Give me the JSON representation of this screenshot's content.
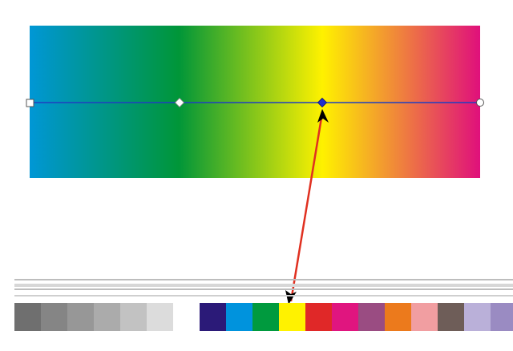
{
  "gradient": {
    "stops": [
      {
        "offset": 0.0,
        "color": "#0097d6"
      },
      {
        "offset": 0.33,
        "color": "#009639"
      },
      {
        "offset": 0.65,
        "color": "#fff200"
      },
      {
        "offset": 1.0,
        "color": "#e0107c"
      }
    ],
    "handle_positions": [
      0.0,
      0.33,
      0.65,
      1.0
    ],
    "selected_handle": 2,
    "line_color": "#1f3fbf"
  },
  "palette": {
    "swatches": [
      {
        "name": "gray-70",
        "color": "#6f6f6f"
      },
      {
        "name": "gray-60",
        "color": "#858585"
      },
      {
        "name": "gray-50",
        "color": "#979797"
      },
      {
        "name": "gray-40",
        "color": "#ababab"
      },
      {
        "name": "gray-30",
        "color": "#c2c2c2"
      },
      {
        "name": "gray-20",
        "color": "#dcdcdc"
      },
      {
        "name": "white",
        "color": "#ffffff"
      },
      {
        "name": "navy",
        "color": "#2b1a78"
      },
      {
        "name": "cyan",
        "color": "#0093dd"
      },
      {
        "name": "green",
        "color": "#009a3e"
      },
      {
        "name": "yellow",
        "color": "#fff200"
      },
      {
        "name": "red",
        "color": "#e02828"
      },
      {
        "name": "magenta",
        "color": "#e0157f"
      },
      {
        "name": "plum",
        "color": "#9a4c82"
      },
      {
        "name": "orange",
        "color": "#ec7a1c"
      },
      {
        "name": "pink",
        "color": "#f19ea1"
      },
      {
        "name": "taupe",
        "color": "#6e5d58"
      },
      {
        "name": "lavender",
        "color": "#bab0d9"
      },
      {
        "name": "purple-gray",
        "color": "#9a8bc2"
      }
    ],
    "target_swatch": 10
  },
  "arrow": {
    "color": "#e03020"
  }
}
